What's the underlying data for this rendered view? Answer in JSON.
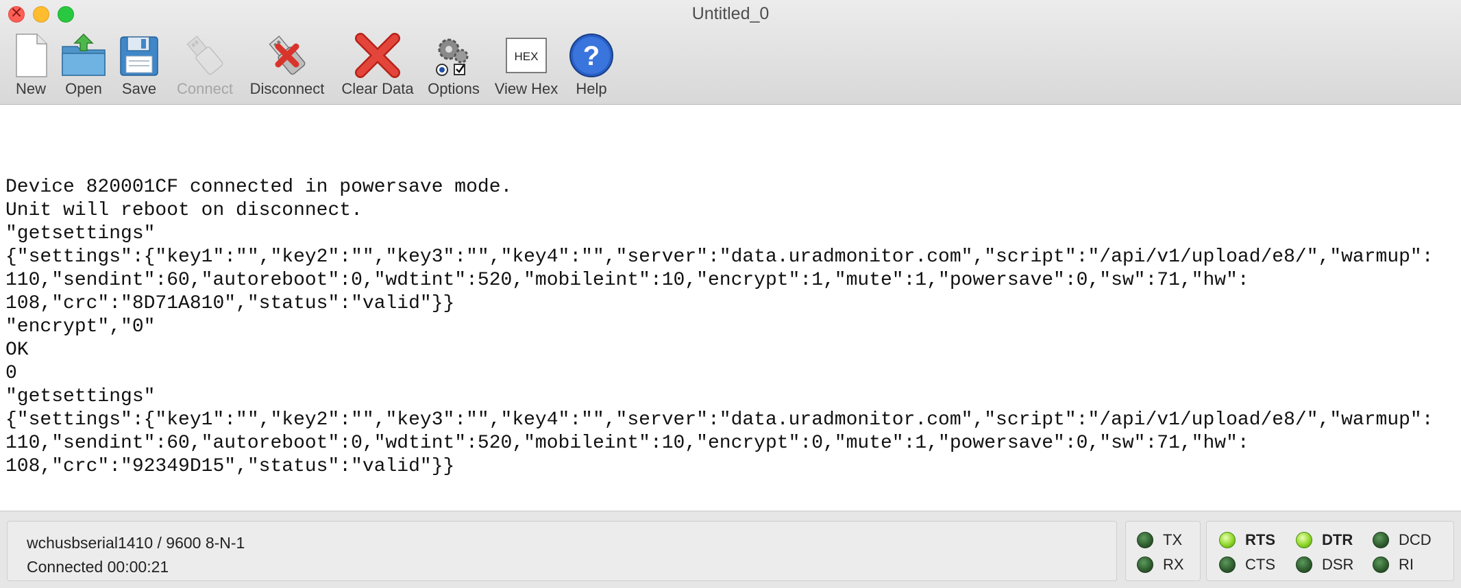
{
  "window": {
    "title": "Untitled_0"
  },
  "toolbar": {
    "buttons": [
      {
        "id": "new",
        "label": "New",
        "icon": "new-document-icon",
        "enabled": true
      },
      {
        "id": "open",
        "label": "Open",
        "icon": "open-folder-icon",
        "enabled": true
      },
      {
        "id": "save",
        "label": "Save",
        "icon": "floppy-disk-icon",
        "enabled": true
      },
      {
        "id": "connect",
        "label": "Connect",
        "icon": "usb-plug-icon",
        "enabled": false
      },
      {
        "id": "disconnect",
        "label": "Disconnect",
        "icon": "usb-disconnect-icon",
        "enabled": true
      },
      {
        "id": "clear",
        "label": "Clear Data",
        "icon": "red-x-icon",
        "enabled": true
      },
      {
        "id": "options",
        "label": "Options",
        "icon": "gears-options-icon",
        "enabled": true
      },
      {
        "id": "viewhex",
        "label": "View Hex",
        "icon": "hex-icon",
        "enabled": true
      },
      {
        "id": "help",
        "label": "Help",
        "icon": "help-icon",
        "enabled": true
      }
    ],
    "hex_glyph": "HEX",
    "help_glyph": "?"
  },
  "terminal": {
    "lines": [
      "Device 820001CF connected in powersave mode.",
      "Unit will reboot on disconnect.",
      "\"getsettings\"",
      "{\"settings\":{\"key1\":\"\",\"key2\":\"\",\"key3\":\"\",\"key4\":\"\",\"server\":\"data.uradmonitor.com\",\"script\":\"/api/v1/upload/e8/\",\"warmup\":",
      "110,\"sendint\":60,\"autoreboot\":0,\"wdtint\":520,\"mobileint\":10,\"encrypt\":1,\"mute\":1,\"powersave\":0,\"sw\":71,\"hw\":",
      "108,\"crc\":\"8D71A810\",\"status\":\"valid\"}}",
      "\"encrypt\",\"0\"",
      "OK",
      "0",
      "\"getsettings\"",
      "{\"settings\":{\"key1\":\"\",\"key2\":\"\",\"key3\":\"\",\"key4\":\"\",\"server\":\"data.uradmonitor.com\",\"script\":\"/api/v1/upload/e8/\",\"warmup\":",
      "110,\"sendint\":60,\"autoreboot\":0,\"wdtint\":520,\"mobileint\":10,\"encrypt\":0,\"mute\":1,\"powersave\":0,\"sw\":71,\"hw\":",
      "108,\"crc\":\"92349D15\",\"status\":\"valid\"}}"
    ]
  },
  "status": {
    "port": "wchusbserial1410 / 9600 8-N-1",
    "connection": "Connected 00:00:21",
    "indicators": {
      "tx": {
        "label": "TX",
        "on": false
      },
      "rx": {
        "label": "RX",
        "on": false
      },
      "rts": {
        "label": "RTS",
        "on": true
      },
      "cts": {
        "label": "CTS",
        "on": false
      },
      "dtr": {
        "label": "DTR",
        "on": true
      },
      "dsr": {
        "label": "DSR",
        "on": false
      },
      "dcd": {
        "label": "DCD",
        "on": false
      },
      "ri": {
        "label": "RI",
        "on": false
      }
    },
    "colors": {
      "led_on": "#8fd62a",
      "led_off": "#2d5a2d"
    }
  }
}
